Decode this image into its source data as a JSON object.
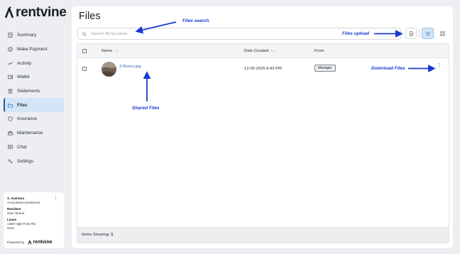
{
  "brand": {
    "name": "rentvine"
  },
  "sidebar": {
    "items": [
      {
        "label": "Summary",
        "icon": "document-icon",
        "active": false
      },
      {
        "label": "Make Payment",
        "icon": "dollar-icon",
        "active": false
      },
      {
        "label": "Activity",
        "icon": "activity-icon",
        "active": false
      },
      {
        "label": "Wallet",
        "icon": "wallet-icon",
        "active": false
      },
      {
        "label": "Statements",
        "icon": "bank-icon",
        "active": false
      },
      {
        "label": "Files",
        "icon": "folder-icon",
        "active": true
      },
      {
        "label": "Insurance",
        "icon": "shield-icon",
        "active": false
      },
      {
        "label": "Maintenance",
        "icon": "toolbox-icon",
        "active": false
      },
      {
        "label": "Chat",
        "icon": "chat-icon",
        "active": false
      },
      {
        "label": "Settings",
        "icon": "settings-icon",
        "active": false
      }
    ]
  },
  "user_card": {
    "name": "S. Guevara",
    "account": "AccountSuccessDemo",
    "resident_label": "Resident",
    "resident_value": "Sam Tenant",
    "lease_label": "Lease",
    "lease_line1": "1458 High Point Rd",
    "lease_line2": "#101",
    "powered_by": "Powered by",
    "powered_brand": "rentvine"
  },
  "main": {
    "title": "Files",
    "search_placeholder": "Search file by name",
    "columns": {
      "name": "Name",
      "date": "Date Created",
      "from": "From"
    },
    "rows": [
      {
        "file_name": "3 Rivers.jpg",
        "date": "12-05-2025 8:43 PM",
        "from": "Manager"
      }
    ],
    "footer_label": "Items Showing:",
    "footer_count": "1"
  },
  "annotations": {
    "files_search": "Files search",
    "files_upload": "Files upload",
    "download_files": "Download Files",
    "shared_files": "Shared Files"
  },
  "colors": {
    "accent": "#1f5fa0",
    "active_bg": "#d3e5f6",
    "link": "#2a6ab8",
    "annotation": "#1a3ad6",
    "page_bg": "#eceef1"
  }
}
